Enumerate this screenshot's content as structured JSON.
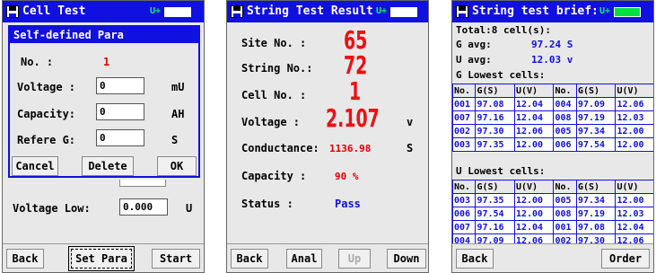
{
  "screen1": {
    "title": "Cell Test",
    "battery_label": "U+",
    "dialog_title": "Self-defined Para",
    "no_label": "No.   :",
    "no_value": "1",
    "voltage_label": "Voltage :",
    "voltage_value": "0",
    "voltage_unit": "mU",
    "capacity_label": "Capacity:",
    "capacity_value": "0",
    "capacity_unit": "AH",
    "referg_label": "Refere G:",
    "referg_value": "0",
    "referg_unit": "S",
    "cancel_label": "Cancel",
    "delete_label": "Delete",
    "ok_label": "OK",
    "voltage_low_label": "Voltage Low:",
    "voltage_low_value": "0.000",
    "voltage_low_unit": "U",
    "back_label": "Back",
    "setpara_label": "Set Para",
    "start_label": "Start"
  },
  "screen2": {
    "title": "String Test Result",
    "battery_label": "U+",
    "site_label": "Site  No. :",
    "site_value": "65",
    "string_label": "String No.:",
    "string_value": "72",
    "cell_label": "Cell No.  :",
    "cell_value": "1",
    "voltage_label": "Voltage   :",
    "voltage_value": "2.107",
    "voltage_unit": "v",
    "conductance_label": "Conductance:",
    "conductance_value": "1136.98",
    "conductance_unit": "S",
    "capacity_label": "Capacity  :",
    "capacity_value": "90 %",
    "status_label": "Status    :",
    "status_value": "Pass",
    "back_label": "Back",
    "anal_label": "Anal",
    "up_label": "Up",
    "down_label": "Down"
  },
  "screen3": {
    "title": "String test brief:",
    "battery_label": "U+",
    "total_text": "Total:8 cell(s):",
    "g_avg_label": "G avg:",
    "g_avg_value": "97.24 S",
    "u_avg_label": "U avg:",
    "u_avg_value": "12.03 v",
    "g_lowest_label": "G Lowest cells:",
    "u_lowest_label": "U Lowest cells:",
    "headers": [
      "No.",
      "G(S)",
      "U(V)",
      "No.",
      "G(S)",
      "U(V)"
    ],
    "g_rows": [
      [
        "001",
        "97.08",
        "12.04",
        "004",
        "97.09",
        "12.06"
      ],
      [
        "007",
        "97.16",
        "12.04",
        "008",
        "97.19",
        "12.03"
      ],
      [
        "002",
        "97.30",
        "12.06",
        "005",
        "97.34",
        "12.00"
      ],
      [
        "003",
        "97.35",
        "12.00",
        "006",
        "97.54",
        "12.00"
      ]
    ],
    "u_rows": [
      [
        "003",
        "97.35",
        "12.00",
        "005",
        "97.34",
        "12.00"
      ],
      [
        "006",
        "97.54",
        "12.00",
        "008",
        "97.19",
        "12.03"
      ],
      [
        "007",
        "97.16",
        "12.04",
        "001",
        "97.08",
        "12.04"
      ],
      [
        "004",
        "97.09",
        "12.06",
        "002",
        "97.30",
        "12.06"
      ]
    ],
    "back_label": "Back",
    "order_label": "Order"
  },
  "colors": {
    "title_bar": "#1010e0",
    "value_red": "#e00000",
    "value_blue": "#1010e0",
    "battery_green": "#00ff40"
  },
  "battery_levels": {
    "screen1": 0.0,
    "screen2": 0.0,
    "screen3": 1.0
  }
}
